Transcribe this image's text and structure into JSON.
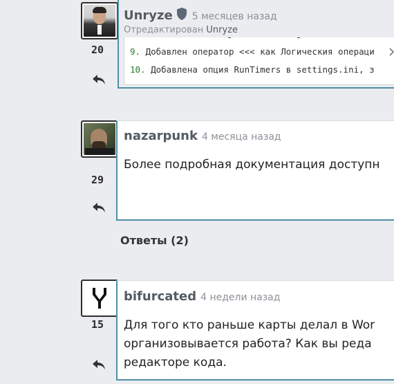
{
  "comments": [
    {
      "author": "Unryze",
      "time": "5 месяцев назад",
      "edited_prefix": "Отредактирован",
      "edited_by": "Unryze",
      "score": "20",
      "code_lines": [
        {
          "num": "9.",
          "text": "Добавлен оператор <<< как Логическия операци"
        },
        {
          "num": "10.",
          "text": "Добавлена опция RunTimers в settings.ini, з"
        }
      ]
    },
    {
      "author": "nazarpunk",
      "time": "4 месяца назад",
      "score": "29",
      "text": "Более подробная документация доступн"
    },
    {
      "author": "bifurcated",
      "time": "4 недели назад",
      "score": "15",
      "text_lines": [
        "Для того кто раньше карты делал в Wor",
        "организовывается работа? Как вы реда",
        "редакторе кода."
      ]
    }
  ],
  "replies_title": "Ответы (2)",
  "colors": {
    "card_border": "#4f8fa6",
    "author": "#535a62",
    "time": "#8b9097"
  },
  "icons": [
    "shield-icon",
    "reply-icon",
    "scroll-arrow-icon",
    "fork-icon"
  ]
}
